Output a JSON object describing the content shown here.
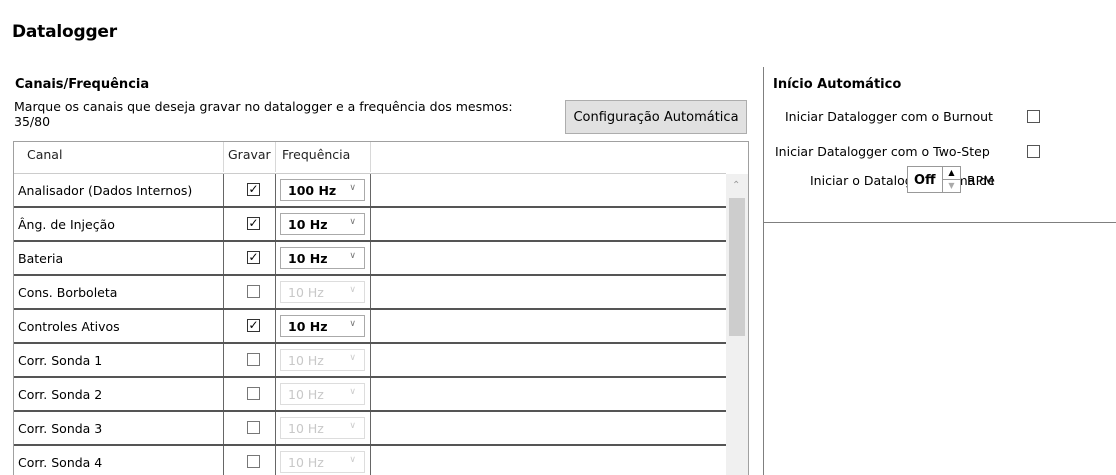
{
  "title": "Datalogger",
  "channels": {
    "section_title": "Canais/Frequência",
    "instructions": "Marque os canais que deseja gravar no datalogger e a frequência dos mesmos:",
    "counter": "35/80",
    "auto_config_label": "Configuração Automática",
    "columns": [
      "Canal",
      "Gravar",
      "Frequência"
    ],
    "rows": [
      {
        "name": "Analisador (Dados Internos)",
        "record": true,
        "freq": "100 Hz"
      },
      {
        "name": "Âng. de Injeção",
        "record": true,
        "freq": "10 Hz"
      },
      {
        "name": "Bateria",
        "record": true,
        "freq": "10 Hz"
      },
      {
        "name": "Cons. Borboleta",
        "record": false,
        "freq": "10 Hz"
      },
      {
        "name": "Controles Ativos",
        "record": true,
        "freq": "10 Hz"
      },
      {
        "name": "Corr. Sonda 1",
        "record": false,
        "freq": "10 Hz"
      },
      {
        "name": "Corr. Sonda 2",
        "record": false,
        "freq": "10 Hz"
      },
      {
        "name": "Corr. Sonda 3",
        "record": false,
        "freq": "10 Hz"
      },
      {
        "name": "Corr. Sonda 4",
        "record": false,
        "freq": "10 Hz"
      }
    ]
  },
  "auto_start": {
    "title": "Início Automático",
    "burnout_label": "Iniciar Datalogger com o Burnout",
    "burnout_checked": false,
    "twostep_label": "Iniciar Datalogger com o Two-Step",
    "twostep_checked": false,
    "rpm_label": "Iniciar o Datalogger acima de",
    "rpm_value": "Off",
    "rpm_unit": "RPM"
  },
  "icons": {
    "dropdown": "chevron-down-icon",
    "spin_up": "triangle-up-icon",
    "spin_down": "triangle-down-icon",
    "scroll_up": "chevron-up-icon",
    "check": "checkmark-icon"
  }
}
